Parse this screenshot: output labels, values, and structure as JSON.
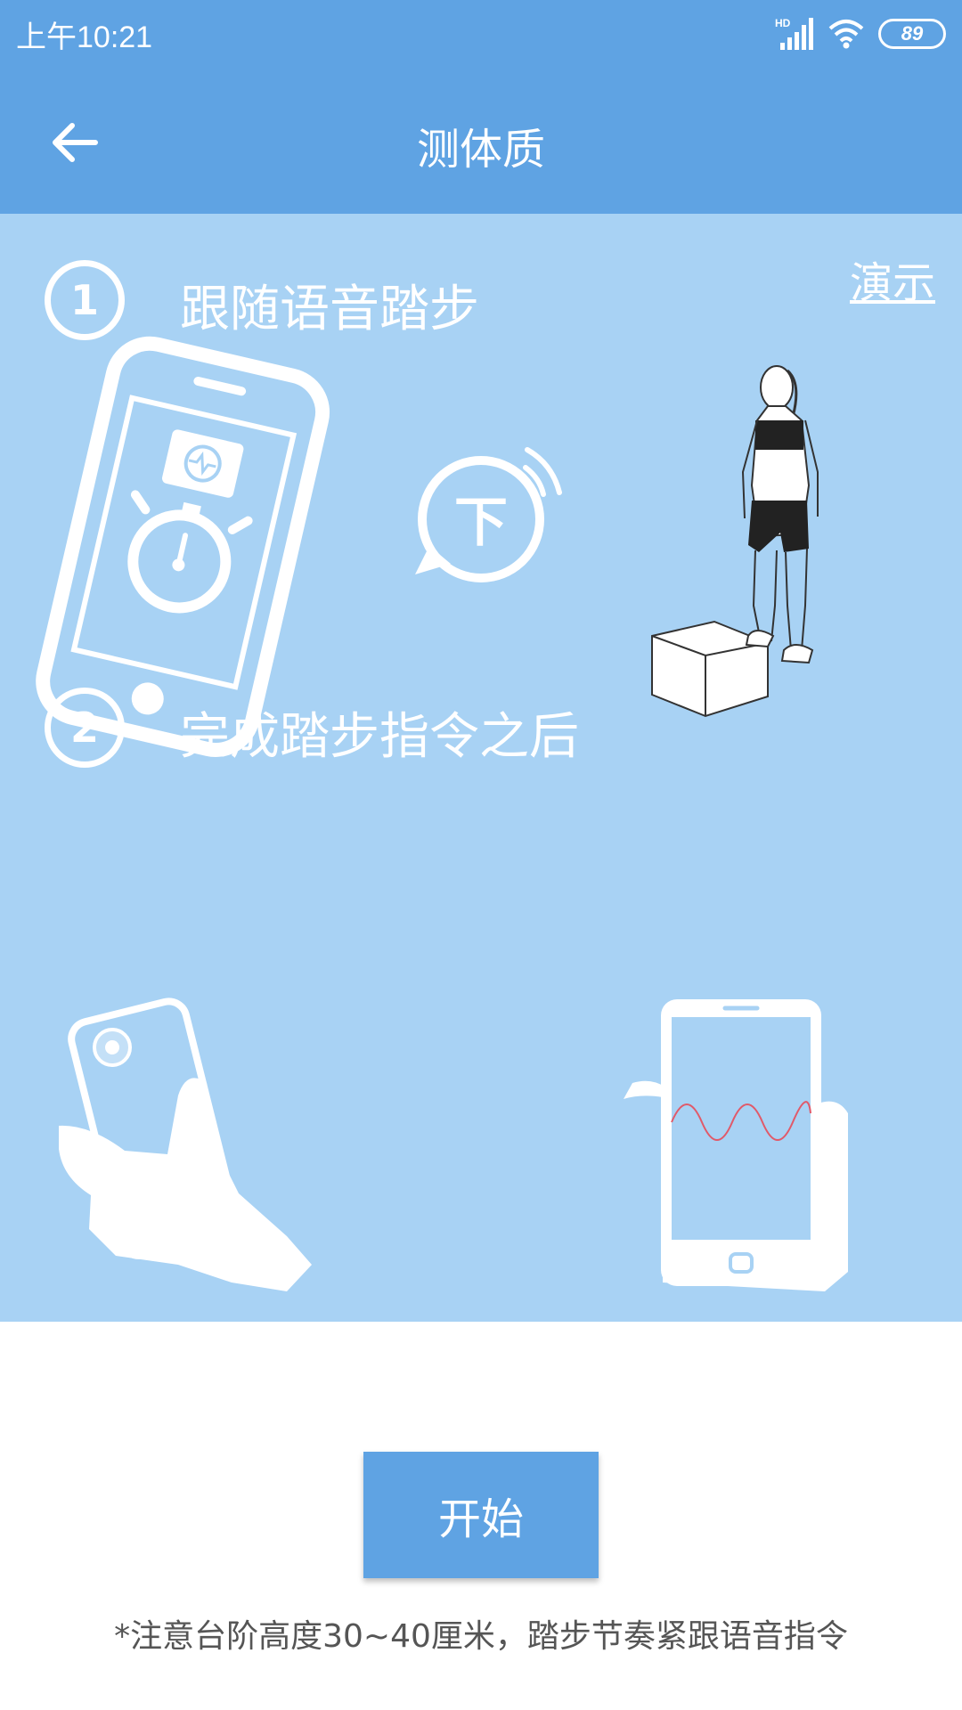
{
  "status": {
    "time": "上午10:21",
    "network": "HD",
    "battery": "89"
  },
  "header": {
    "title": "测体质"
  },
  "steps": [
    {
      "number": "1",
      "label": "跟随语音踏步"
    },
    {
      "number": "2",
      "label": "完成踏步指令之后"
    }
  ],
  "demo_label": "演示",
  "voice_cue": "下",
  "start_label": "开始",
  "note": "*注意台阶高度30~40厘米，踏步节奏紧跟语音指令",
  "colors": {
    "primary": "#5fa3e3",
    "illustration_bg": "#a8d2f4",
    "wave": "#e05a6a"
  }
}
